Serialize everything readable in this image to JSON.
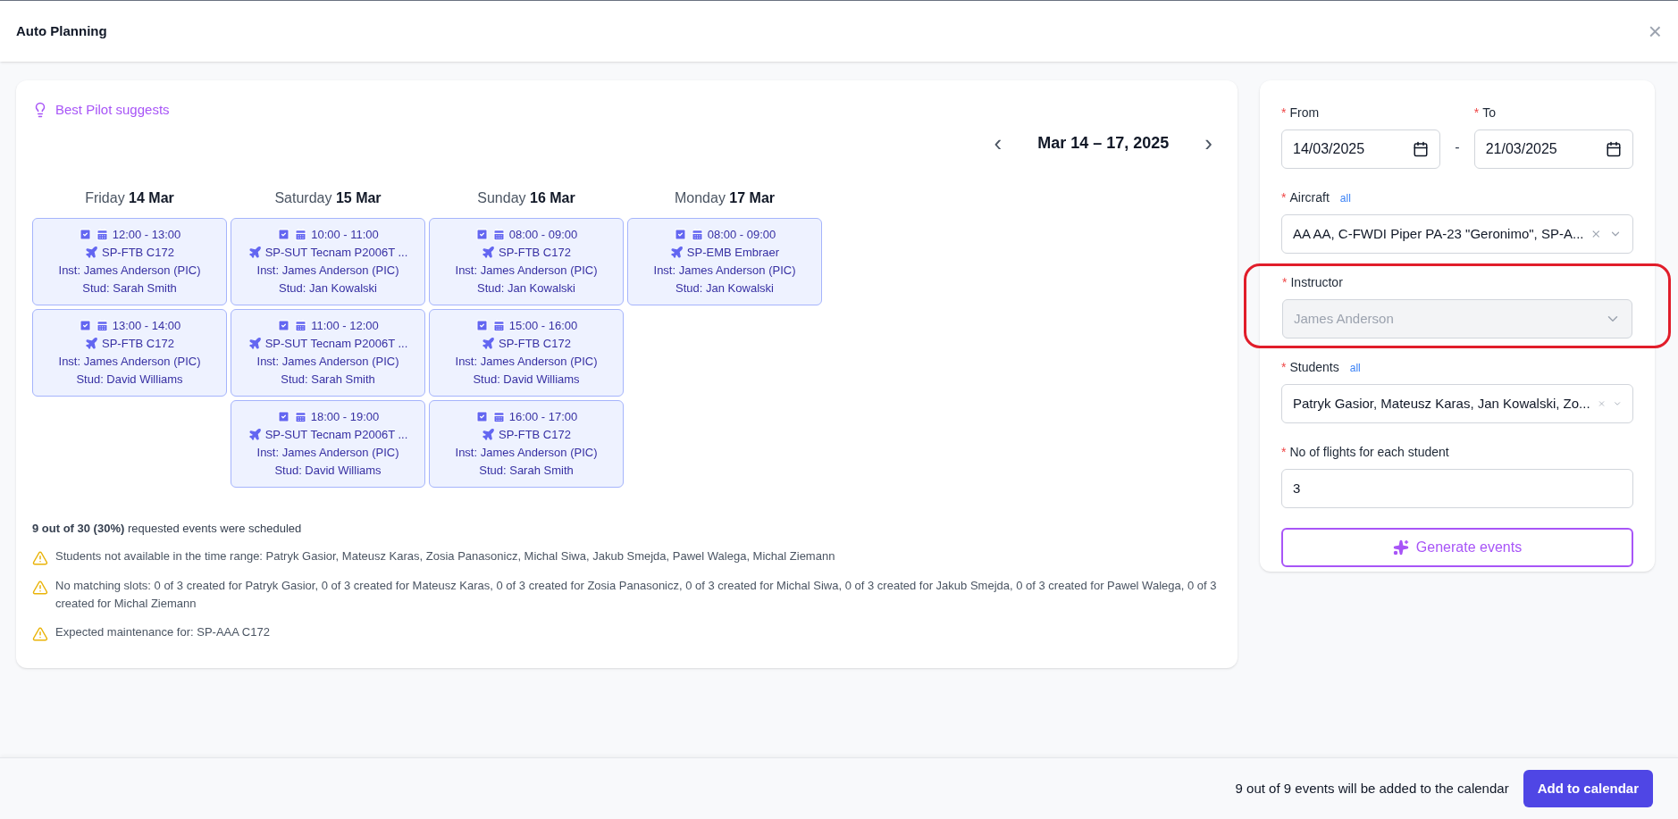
{
  "window": {
    "title": "Auto Planning",
    "close": "×"
  },
  "suggest": {
    "label": "Best Pilot suggests"
  },
  "calendar": {
    "range": "Mar 14 – 17, 2025",
    "prev": "‹",
    "next": "›",
    "days": [
      {
        "weekday": "Friday",
        "date": "14 Mar",
        "events": [
          {
            "checked": true,
            "time": "12:00 - 13:00",
            "aircraft": "SP-FTB C172",
            "instructor": "Inst: James Anderson (PIC)",
            "student": "Stud: Sarah Smith"
          },
          {
            "checked": true,
            "time": "13:00 - 14:00",
            "aircraft": "SP-FTB C172",
            "instructor": "Inst: James Anderson (PIC)",
            "student": "Stud: David Williams"
          }
        ]
      },
      {
        "weekday": "Saturday",
        "date": "15 Mar",
        "events": [
          {
            "checked": true,
            "time": "10:00 - 11:00",
            "aircraft": "SP-SUT Tecnam P2006T ...",
            "instructor": "Inst: James Anderson (PIC)",
            "student": "Stud: Jan Kowalski"
          },
          {
            "checked": true,
            "time": "11:00 - 12:00",
            "aircraft": "SP-SUT Tecnam P2006T ...",
            "instructor": "Inst: James Anderson (PIC)",
            "student": "Stud: Sarah Smith"
          },
          {
            "checked": true,
            "time": "18:00 - 19:00",
            "aircraft": "SP-SUT Tecnam P2006T ...",
            "instructor": "Inst: James Anderson (PIC)",
            "student": "Stud: David Williams"
          }
        ]
      },
      {
        "weekday": "Sunday",
        "date": "16 Mar",
        "events": [
          {
            "checked": true,
            "time": "08:00 - 09:00",
            "aircraft": "SP-FTB C172",
            "instructor": "Inst: James Anderson (PIC)",
            "student": "Stud: Jan Kowalski"
          },
          {
            "checked": true,
            "time": "15:00 - 16:00",
            "aircraft": "SP-FTB C172",
            "instructor": "Inst: James Anderson (PIC)",
            "student": "Stud: David Williams"
          },
          {
            "checked": true,
            "time": "16:00 - 17:00",
            "aircraft": "SP-FTB C172",
            "instructor": "Inst: James Anderson (PIC)",
            "student": "Stud: Sarah Smith"
          }
        ]
      },
      {
        "weekday": "Monday",
        "date": "17 Mar",
        "events": [
          {
            "checked": true,
            "time": "08:00 - 09:00",
            "aircraft": "SP-EMB Embraer",
            "instructor": "Inst: James Anderson (PIC)",
            "student": "Stud: Jan Kowalski"
          }
        ]
      }
    ]
  },
  "summary": "**9 out of 30 (30%)** requested events were scheduled",
  "warnings": [
    "Students not available in the time range: Patryk Gasior, Mateusz Karas, Zosia Panasonicz, Michal Siwa, Jakub Smejda, Pawel Walega, Michal Ziemann",
    "No matching slots: 0 of 3 created for Patryk Gasior, 0 of 3 created for Mateusz Karas, 0 of 3 created for Zosia Panasonicz, 0 of 3 created for Michal Siwa, 0 of 3 created for Jakub Smejda, 0 of 3 created for Pawel Walega, 0 of 3 created for Michal Ziemann",
    "Expected maintenance for: SP-AAA C172"
  ],
  "form": {
    "from": {
      "required": "*",
      "label": "From",
      "value": "14/03/2025"
    },
    "separator": "-",
    "to": {
      "required": "*",
      "label": "To",
      "value": "21/03/2025"
    },
    "aircraft": {
      "required": "*",
      "label": "Aircraft",
      "all": "all",
      "value": "AA AA, C-FWDI Piper PA-23 \"Geronimo\", SP-A...",
      "disabled": false
    },
    "instructor": {
      "required": "*",
      "label": "Instructor",
      "value": "James Anderson",
      "disabled": true,
      "highlighted": true
    },
    "students": {
      "required": "*",
      "label": "Students",
      "all": "all",
      "value": "Patryk Gasior, Mateusz Karas, Jan Kowalski, Zo...",
      "disabled": false
    },
    "flights": {
      "required": "*",
      "label": "No of flights for each student",
      "value": "3"
    },
    "generate": "Generate events"
  },
  "footer": {
    "status": "9 out of 9 events will be added to the calendar",
    "button": "Add to calendar"
  }
}
